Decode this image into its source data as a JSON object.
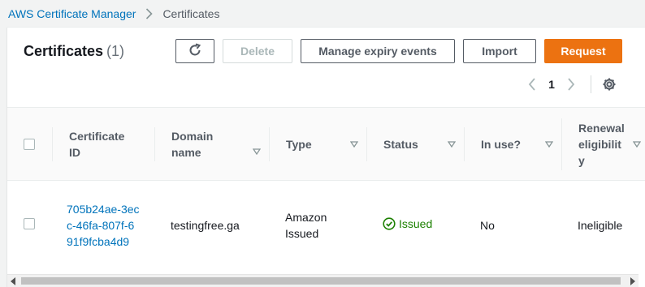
{
  "breadcrumb": {
    "parent": "AWS Certificate Manager",
    "current": "Certificates"
  },
  "header": {
    "title": "Certificates",
    "count": "(1)"
  },
  "toolbar": {
    "refresh_icon": "refresh-icon",
    "delete_label": "Delete",
    "manage_label": "Manage expiry events",
    "import_label": "Import",
    "request_label": "Request"
  },
  "pagination": {
    "current_page": "1"
  },
  "table": {
    "columns": [
      {
        "label": "Certificate ID"
      },
      {
        "label": "Domain name"
      },
      {
        "label": "Type"
      },
      {
        "label": "Status"
      },
      {
        "label": "In use?"
      },
      {
        "label": "Renewal eligibility"
      }
    ],
    "rows": [
      {
        "certificate_id": "705b24ae-3ecc-46fa-807f-691f9fcba4d9",
        "domain_name": "testingfree.ga",
        "type": "Amazon Issued",
        "status": "Issued",
        "in_use": "No",
        "renewal_eligibility": "Ineligible"
      }
    ]
  },
  "colors": {
    "link": "#0073bb",
    "primary": "#ec7211",
    "success": "#1d8102"
  }
}
